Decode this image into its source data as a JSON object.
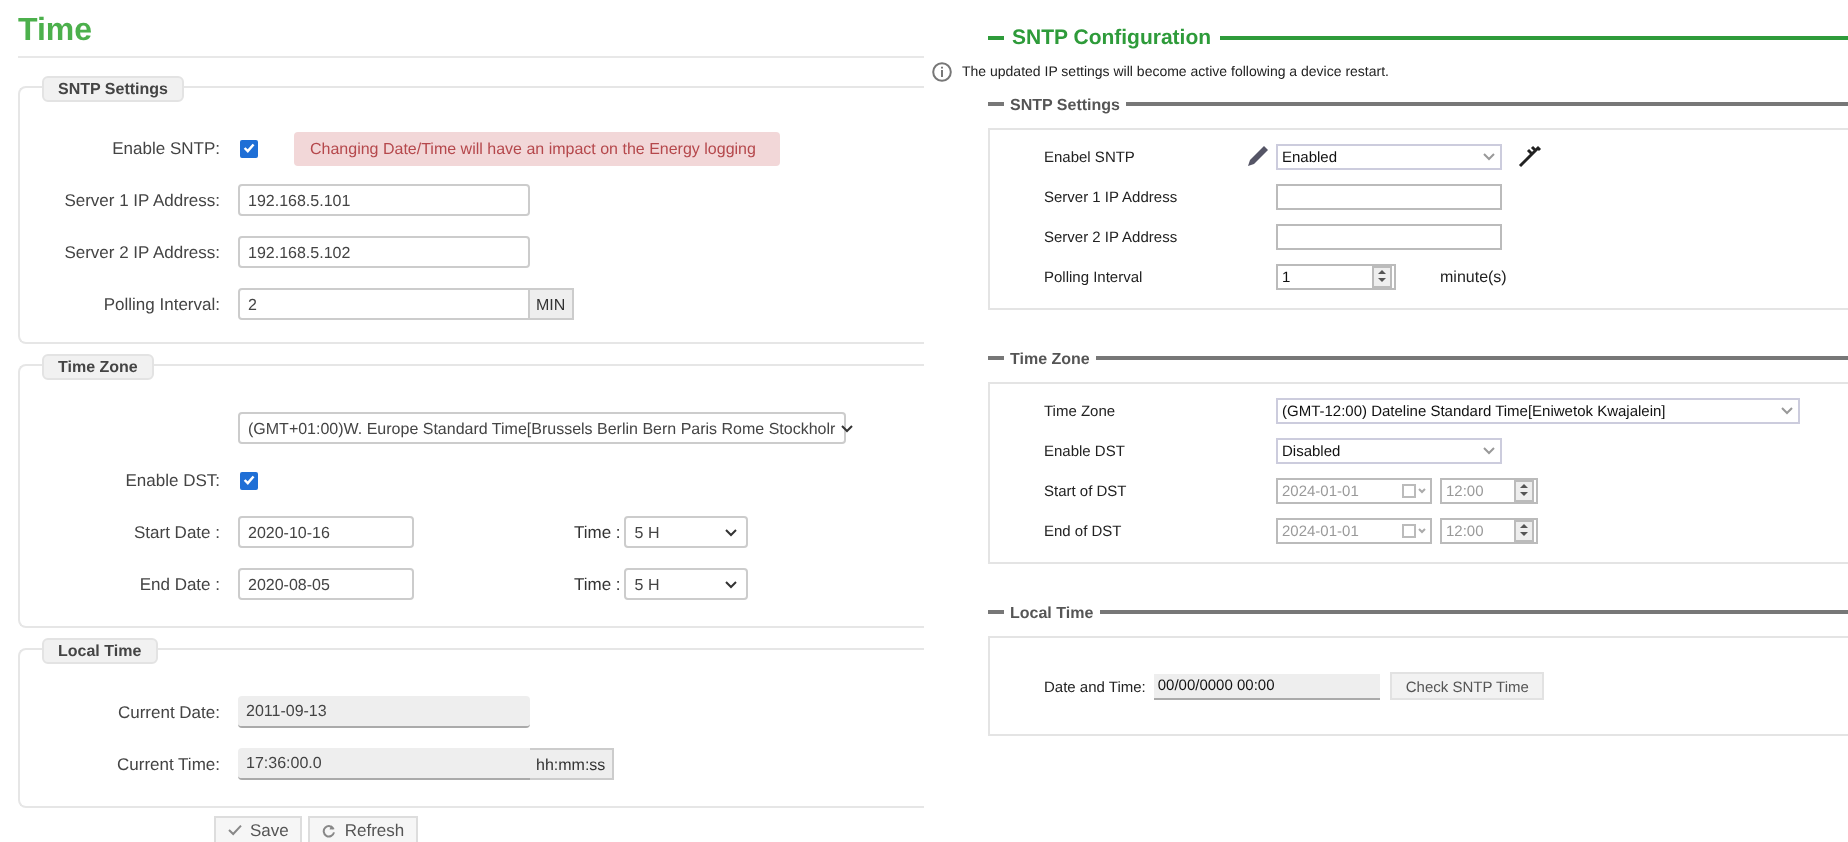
{
  "left_panel": {
    "title": "Time",
    "sections": [
      {
        "legend": "SNTP Settings",
        "rows": [
          {
            "kind": "checkbox",
            "label": "Enable SNTP:",
            "checked": true,
            "alert": "Changing Date/Time will have an impact on the Energy logging"
          },
          {
            "kind": "text",
            "label": "Server 1 IP Address:",
            "value": "192.168.5.101"
          },
          {
            "kind": "text",
            "label": "Server 2 IP Address:",
            "value": "192.168.5.102"
          },
          {
            "kind": "addon",
            "label": "Polling Interval:",
            "value": "2",
            "unit": "MIN"
          }
        ]
      },
      {
        "legend": "Time Zone",
        "rows": [
          {
            "kind": "select",
            "value": "(GMT+01:00)W. Europe Standard Time[Brussels Berlin Bern Paris Rome Stockholr"
          },
          {
            "kind": "checkbox",
            "label": "Enable DST:",
            "checked": true
          },
          {
            "kind": "date_time",
            "label": "Start Date :",
            "value": "2020-10-16",
            "time_label": "Time :",
            "time_value": "5 H"
          },
          {
            "kind": "date_time",
            "label": "End Date :",
            "value": "2020-08-05",
            "time_label": "Time :",
            "time_value": "5 H"
          }
        ]
      },
      {
        "legend": "Local Time",
        "rows": [
          {
            "kind": "readonly",
            "label": "Current Date:",
            "value": "2011-09-13"
          },
          {
            "kind": "readonly_addon",
            "label": "Current Time:",
            "value": "17:36:00.0",
            "unit": "hh:mm:ss"
          }
        ]
      }
    ],
    "buttons": [
      {
        "kind": "save",
        "label": "Save"
      },
      {
        "kind": "refresh",
        "label": "Refresh"
      }
    ]
  },
  "right_panel": {
    "title": "SNTP Configuration",
    "info": "The updated IP settings will become active following a device restart.",
    "sections": [
      {
        "legend": "SNTP Settings",
        "rows": [
          {
            "kind": "edit_select",
            "label": "Enabel SNTP",
            "value": "Enabled"
          },
          {
            "kind": "text",
            "label": "Server 1 IP Address"
          },
          {
            "kind": "text",
            "label": "Server 2 IP Address"
          },
          {
            "kind": "spinner",
            "label": "Polling Interval",
            "value": "1",
            "unit": "minute(s)"
          }
        ]
      },
      {
        "legend": "Time Zone",
        "rows": [
          {
            "kind": "wide_select",
            "label": "Time Zone",
            "value": "(GMT-12:00) Dateline Standard Time[Eniwetok Kwajalein]"
          },
          {
            "kind": "select",
            "label": "Enable DST",
            "value": "Disabled"
          },
          {
            "kind": "date_time",
            "label": "Start of DST",
            "date": "2024-01-01",
            "time": "12:00",
            "disabled": true
          },
          {
            "kind": "date_time",
            "label": "End of DST",
            "date": "2024-01-01",
            "time": "12:00",
            "disabled": true
          }
        ]
      },
      {
        "legend": "Local Time",
        "rows": [
          {
            "kind": "readonly_button",
            "label": "Date and Time:",
            "value": "00/00/0000 00:00",
            "button": "Check SNTP Time"
          }
        ]
      }
    ]
  }
}
